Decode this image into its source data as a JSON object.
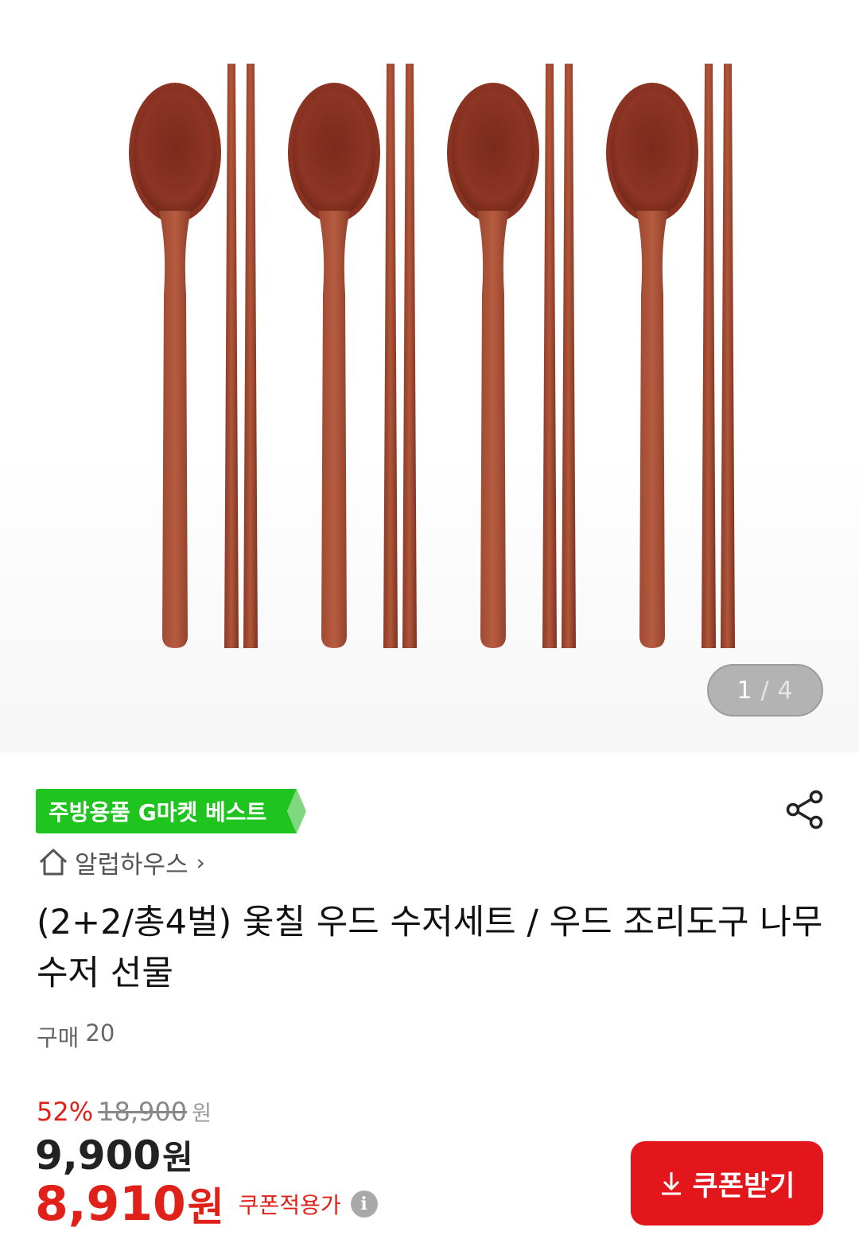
{
  "gallery": {
    "current_index": "1",
    "separator": "/",
    "total": "4",
    "image_alt": "wooden spoon and chopstick sets"
  },
  "badge": {
    "label": "주방용품 G마켓 베스트",
    "color": "#1fc41f"
  },
  "store": {
    "name": "알럽하우스",
    "icon": "home-icon",
    "chevron": "›"
  },
  "product": {
    "title": "(2+2/총4벌) 옻칠 우드 수저세트 / 우드 조리도구 나무 수저 선물",
    "purchase_label": "구매",
    "purchase_count": "20"
  },
  "price": {
    "discount_rate": "52%",
    "original": "18,900",
    "original_unit": "원",
    "sale": "9,900",
    "sale_unit": "원",
    "coupon_price": "8,910",
    "coupon_unit": "원",
    "coupon_label": "쿠폰적용가",
    "info_icon": "i",
    "accent_color": "#e0211a"
  },
  "actions": {
    "coupon_button": "쿠폰받기",
    "share_icon": "share-icon",
    "download_icon": "download-icon"
  }
}
